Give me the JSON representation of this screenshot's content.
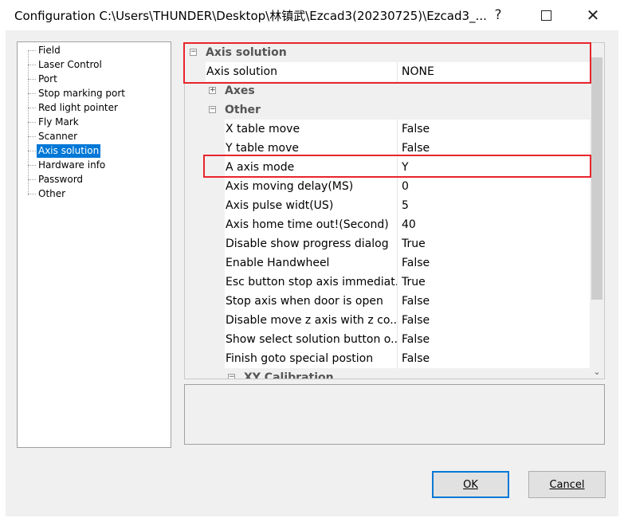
{
  "window": {
    "title": "Configuration C:\\Users\\THUNDER\\Desktop\\林镇武\\Ezcad3(20230725)\\Ezcad3_...",
    "help_glyph": "?",
    "close_glyph": "✕"
  },
  "tree": {
    "items": [
      {
        "label": "Field"
      },
      {
        "label": "Laser Control"
      },
      {
        "label": "Port"
      },
      {
        "label": "Stop marking port"
      },
      {
        "label": "Red light pointer"
      },
      {
        "label": "Fly Mark"
      },
      {
        "label": "Scanner"
      },
      {
        "label": "Axis solution",
        "selected": true
      },
      {
        "label": "Hardware info"
      },
      {
        "label": "Password"
      },
      {
        "label": "Other"
      }
    ]
  },
  "grid": {
    "cat_axis_solution": {
      "label": "Axis solution",
      "expander": "−"
    },
    "prop_axis_solution": {
      "name": "Axis solution",
      "value": "NONE"
    },
    "cat_axes": {
      "label": "Axes",
      "expander": "+"
    },
    "cat_other": {
      "label": "Other",
      "expander": "−"
    },
    "other_props": [
      {
        "name": "X table move",
        "value": "False"
      },
      {
        "name": "Y table move",
        "value": "False"
      },
      {
        "name": "A axis mode",
        "value": "Y"
      },
      {
        "name": "Axis moving delay(MS)",
        "value": "0"
      },
      {
        "name": "Axis pulse widt(US)",
        "value": "5"
      },
      {
        "name": "Axis home time out!(Second)",
        "value": "40"
      },
      {
        "name": "Disable show progress dialog",
        "value": "True"
      },
      {
        "name": "Enable Handwheel",
        "value": "False"
      },
      {
        "name": "Esc button stop axis immediat...",
        "value": "True"
      },
      {
        "name": "Stop axis when door is open",
        "value": "False"
      },
      {
        "name": "Disable move z axis with z co...",
        "value": "False"
      },
      {
        "name": "Show select solution button o...",
        "value": "False"
      },
      {
        "name": "Finish goto special postion",
        "value": "False"
      }
    ],
    "cat_xy_calibration": {
      "label": "XY Calibration",
      "expander": "−"
    }
  },
  "buttons": {
    "ok_label": "OK",
    "cancel_label": "Cancel"
  },
  "colors": {
    "selection": "#0078d7",
    "highlight_box": "#e8242c"
  }
}
